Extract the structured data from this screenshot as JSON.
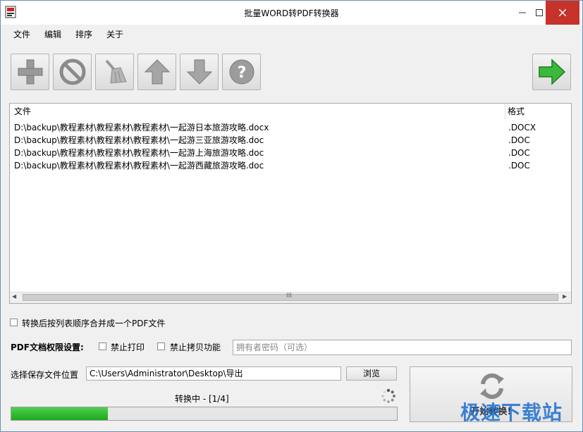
{
  "window": {
    "title": "批量WORD转PDF转换器"
  },
  "menu": [
    "文件",
    "编辑",
    "排序",
    "关于"
  ],
  "toolbar": {
    "buttons": [
      "add-icon",
      "remove-icon",
      "clear-icon",
      "move-up-icon",
      "move-down-icon",
      "help-icon"
    ],
    "start": "start-arrow-icon"
  },
  "file_list": {
    "columns": [
      "文件",
      "格式"
    ],
    "rows": [
      {
        "path": "D:\\backup\\教程素材\\教程素材\\教程素材\\一起游日本旅游攻略.docx",
        "format": ".DOCX"
      },
      {
        "path": "D:\\backup\\教程素材\\教程素材\\教程素材\\一起游三亚旅游攻略.doc",
        "format": ".DOC"
      },
      {
        "path": "D:\\backup\\教程素材\\教程素材\\教程素材\\一起游上海旅游攻略.doc",
        "format": ".DOC"
      },
      {
        "path": "D:\\backup\\教程素材\\教程素材\\教程素材\\一起游西藏旅游攻略.doc",
        "format": ".DOC"
      }
    ],
    "scroll_grip": "III"
  },
  "merge": {
    "label": "转换后按列表顺序合并成一个PDF文件"
  },
  "permissions": {
    "title": "PDF文档权限设置:",
    "no_print": "禁止打印",
    "no_copy": "禁止拷贝功能",
    "owner_password_placeholder": "拥有者密码（可选）"
  },
  "save": {
    "label": "选择保存文件位置",
    "path": "C:\\Users\\Administrator\\Desktop\\导出",
    "browse": "浏览"
  },
  "status": {
    "text": "转换中 - [1/4]",
    "progress_fraction": 0.25
  },
  "action": {
    "start_label": "开始转换!"
  },
  "watermark": "极速下载站",
  "colors": {
    "progress": "#2db52d",
    "close": "#c7322a",
    "arrow": "#2f9e2f"
  }
}
